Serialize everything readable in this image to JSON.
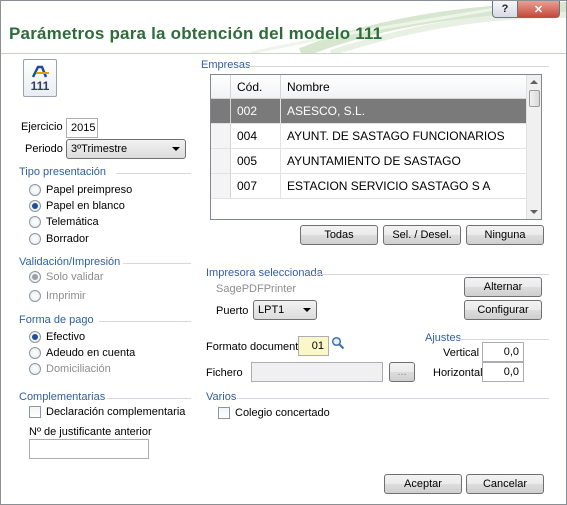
{
  "window": {
    "title": "Parámetros para la obtención del modelo 111",
    "help_button": "?",
    "close_button": "✕",
    "logo_text": "111"
  },
  "ejercicio": {
    "label": "Ejercicio",
    "value": "2015"
  },
  "periodo": {
    "label": "Periodo",
    "value": "3ºTrimestre"
  },
  "tipo_presentacion": {
    "title": "Tipo presentación",
    "options": [
      "Papel preimpreso",
      "Papel en blanco",
      "Telemática",
      "Borrador"
    ],
    "selected": "Papel en blanco"
  },
  "validacion": {
    "title": "Validación/Impresión",
    "options": [
      "Solo validar",
      "Imprimir"
    ],
    "selected": "Solo validar"
  },
  "forma_pago": {
    "title": "Forma de pago",
    "options": [
      "Efectivo",
      "Adeudo en cuenta",
      "Domiciliación"
    ],
    "selected": "Efectivo"
  },
  "complementarias": {
    "title": "Complementarias",
    "checkbox_label": "Declaración complementaria",
    "justificante_label": "Nº de justificante anterior",
    "justificante_value": ""
  },
  "empresas": {
    "title": "Empresas",
    "columns": [
      "Cód.",
      "Nombre"
    ],
    "rows": [
      {
        "cod": "002",
        "nombre": "ASESCO, S.L."
      },
      {
        "cod": "004",
        "nombre": "AYUNT. DE SASTAGO FUNCIONARIOS"
      },
      {
        "cod": "005",
        "nombre": "AYUNTAMIENTO DE SASTAGO"
      },
      {
        "cod": "007",
        "nombre": "ESTACION SERVICIO SASTAGO S A"
      }
    ],
    "selected_cod": "002",
    "buttons": {
      "todas": "Todas",
      "sel_desel": "Sel. / Desel.",
      "ninguna": "Ninguna"
    }
  },
  "impresora": {
    "title": "Impresora seleccionada",
    "name": "SagePDFPrinter",
    "puerto_label": "Puerto",
    "puerto_value": "LPT1",
    "alternar": "Alternar",
    "configurar": "Configurar"
  },
  "formato": {
    "label": "Formato documento",
    "value": "01"
  },
  "fichero": {
    "label": "Fichero",
    "value": "",
    "browse": "..."
  },
  "ajustes": {
    "title": "Ajustes",
    "vertical_label": "Vertical",
    "vertical_value": "0,0",
    "horizontal_label": "Horizontal",
    "horizontal_value": "0,0"
  },
  "varios": {
    "title": "Varios",
    "checkbox_label": "Colegio concertado"
  },
  "footer": {
    "aceptar": "Aceptar",
    "cancelar": "Cancelar"
  },
  "colors": {
    "title_green": "#2d6d3a",
    "section_blue": "#2f5fa0",
    "selection_gray": "#7a7a7a"
  }
}
